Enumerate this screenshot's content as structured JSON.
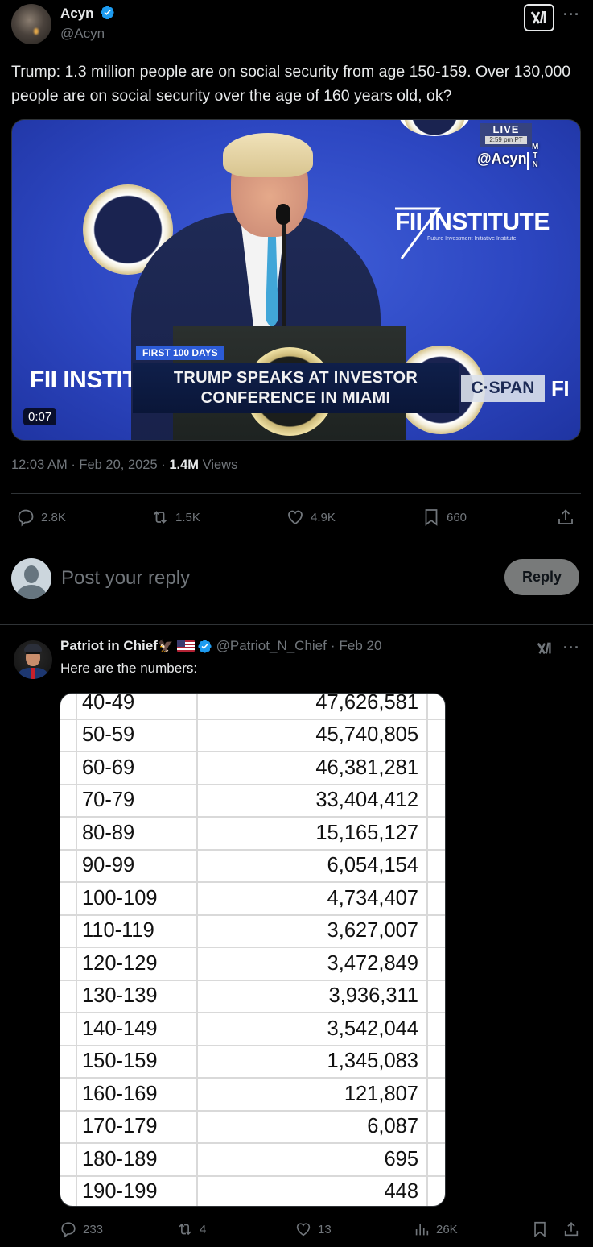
{
  "main_post": {
    "author": {
      "display_name": "Acyn",
      "handle": "@Acyn",
      "verified": true
    },
    "text": "Trump: 1.3 million people are on social security from age 150-159. Over 130,000 people are on social security over the age of 160 years old, ok?",
    "video": {
      "duration": "0:07",
      "live_label": "LIVE",
      "live_time": "2:59 pm PT",
      "watermark": "@Acyn",
      "watermark_network": [
        "M",
        "T",
        "N"
      ],
      "chyron_tag": "FIRST 100 DAYS",
      "chyron_line1": "TRUMP SPEAKS AT INVESTOR",
      "chyron_line2": "CONFERENCE IN MIAMI",
      "network_logo": "C·SPAN",
      "backdrop_logo": "FII INSTITUTE",
      "backdrop_sub": "Future Investment Initiative Institute",
      "backdrop_logo_partial_left": "FII INSTIT",
      "backdrop_logo_partial_right": "FI"
    },
    "time": "12:03 AM",
    "date": "Feb 20, 2025",
    "views_count": "1.4M",
    "views_label": "Views",
    "actions": {
      "replies": "2.8K",
      "reposts": "1.5K",
      "likes": "4.9K",
      "bookmarks": "660"
    },
    "icons": [
      "grok-icon",
      "more-icon",
      "reply-icon",
      "repost-icon",
      "like-icon",
      "bookmark-icon",
      "share-icon"
    ]
  },
  "composer": {
    "placeholder": "Post your reply",
    "button_label": "Reply"
  },
  "reply_post": {
    "author": {
      "display_name": "Patriot in Chief",
      "emoji": "🦅",
      "handle": "@Patriot_N_Chief",
      "verified": true
    },
    "separator": "·",
    "date": "Feb 20",
    "text": "Here are the numbers:",
    "table": {
      "rows": [
        {
          "age": "40-49",
          "count": "47,626,581"
        },
        {
          "age": "50-59",
          "count": "45,740,805"
        },
        {
          "age": "60-69",
          "count": "46,381,281"
        },
        {
          "age": "70-79",
          "count": "33,404,412"
        },
        {
          "age": "80-89",
          "count": "15,165,127"
        },
        {
          "age": "90-99",
          "count": "6,054,154"
        },
        {
          "age": "100-109",
          "count": "4,734,407"
        },
        {
          "age": "110-119",
          "count": "3,627,007"
        },
        {
          "age": "120-129",
          "count": "3,472,849"
        },
        {
          "age": "130-139",
          "count": "3,936,311"
        },
        {
          "age": "140-149",
          "count": "3,542,044"
        },
        {
          "age": "150-159",
          "count": "1,345,083"
        },
        {
          "age": "160-169",
          "count": "121,807"
        },
        {
          "age": "170-179",
          "count": "6,087"
        },
        {
          "age": "180-189",
          "count": "695"
        },
        {
          "age": "190-199",
          "count": "448"
        }
      ]
    },
    "actions": {
      "replies": "233",
      "reposts": "4",
      "likes": "13",
      "views": "26K"
    }
  }
}
